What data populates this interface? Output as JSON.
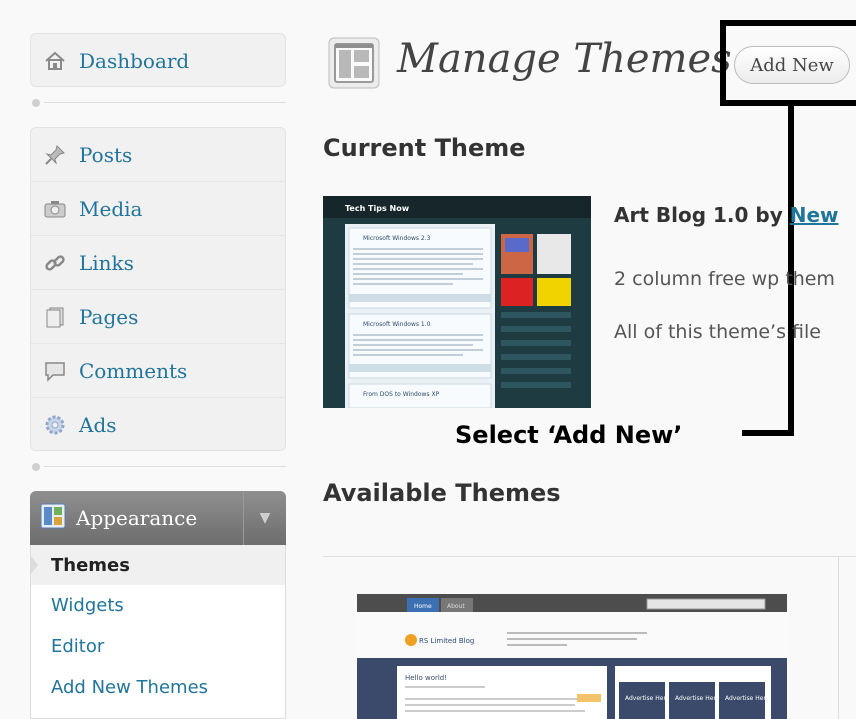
{
  "menu_top": {
    "dashboard": "Dashboard"
  },
  "menu_content": {
    "posts": "Posts",
    "media": "Media",
    "links": "Links",
    "pages": "Pages",
    "comments": "Comments",
    "ads": "Ads"
  },
  "appearance": {
    "label": "Appearance",
    "toggle": "▼",
    "submenu": {
      "themes": "Themes",
      "widgets": "Widgets",
      "editor": "Editor",
      "add_new_themes": "Add New Themes"
    }
  },
  "header": {
    "title": "Manage Themes",
    "add_new": "Add New"
  },
  "callout": {
    "text": "Select ‘Add New’"
  },
  "current_theme": {
    "heading": "Current Theme",
    "title_prefix": "Art Blog 1.0 by ",
    "author": "New",
    "description": "2 column free wp them",
    "files": "All of this theme’s file",
    "thumb": {
      "header": "Tech Tips Now",
      "post1": "Microsoft Windows 2.3",
      "post2": "Microsoft Windows 1.0",
      "post3": "From DOS to Windows XP"
    }
  },
  "available_themes": {
    "heading": "Available Themes",
    "thumb": {
      "tab_home": "Home",
      "tab_about": "About",
      "blog_name": "RS Limited Blog",
      "post_title": "Hello world!",
      "ad1": "Advertise Here",
      "ad2": "Advertise Here",
      "ad3": "Advertise Here"
    }
  }
}
